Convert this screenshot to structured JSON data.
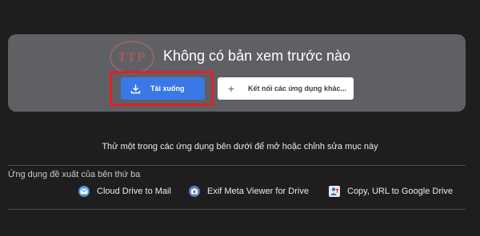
{
  "preview": {
    "title": "Không có bản xem trước nào",
    "watermark": "TTP",
    "download_label": "Tải xuống",
    "connect_label": "Kết nối các ứng dụng khác...",
    "connect_plus": "+"
  },
  "apps": {
    "try_text": "Thử một trong các ứng dụng bên dưới để mở hoặc chỉnh sửa mục này",
    "suggested_heading": "Ứng dụng đề xuất của bên thứ ba",
    "items": [
      {
        "label": "Cloud Drive to Mail",
        "icon": "cloud-mail-icon"
      },
      {
        "label": "Exif Meta Viewer for Drive",
        "icon": "camera-icon"
      },
      {
        "label": "Copy, URL to Google Drive",
        "icon": "user-upload-icon"
      }
    ]
  },
  "colors": {
    "background": "#1e1e1f",
    "card": "#5f6063",
    "accent_blue": "#3b78e7",
    "highlight_red": "#e0202a"
  }
}
